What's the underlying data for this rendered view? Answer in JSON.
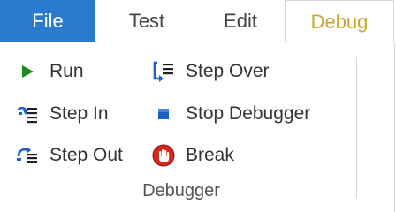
{
  "tabs": {
    "file": "File",
    "test": "Test",
    "edit": "Edit",
    "debug": "Debug"
  },
  "debugger_group": {
    "label": "Debugger",
    "run": "Run",
    "step_in": "Step In",
    "step_out": "Step Out",
    "step_over": "Step Over",
    "stop_debugger": "Stop Debugger",
    "break": "Break"
  },
  "colors": {
    "file_tab_bg": "#2a7ad0",
    "active_tab_text": "#c7a92c",
    "run_icon": "#1f8a1f",
    "stop_icon": "#1d5fc9",
    "break_icon": "#d8261c"
  },
  "icons": {
    "run": "play-icon",
    "step_in": "step-in-icon",
    "step_out": "step-out-icon",
    "step_over": "step-over-icon",
    "stop_debugger": "stop-icon",
    "break": "break-hand-icon"
  }
}
